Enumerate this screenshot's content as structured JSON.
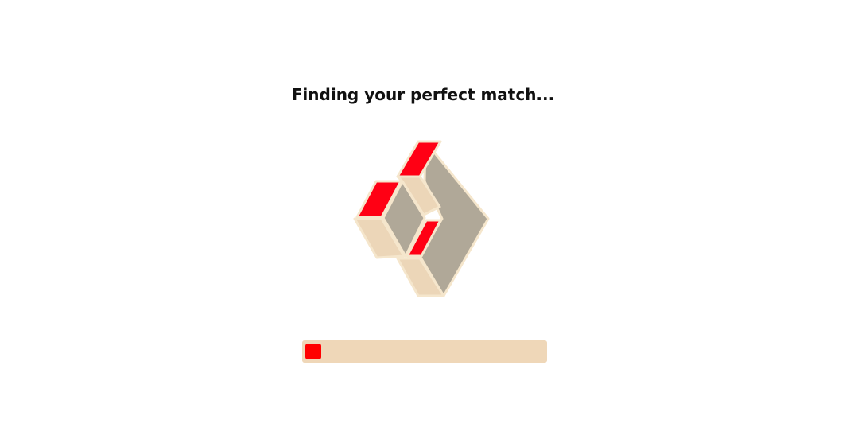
{
  "loading": {
    "title": "Finding your perfect match..."
  },
  "logo": {
    "icon": "isometric-cube-logo-icon",
    "colors": {
      "accent": "#ff0014",
      "shadow": "#b0a898",
      "light": "#ecd6b8",
      "outline": "#f5e6cc"
    }
  },
  "progress": {
    "value_fraction": 0.065,
    "track_color": "#efd7b8",
    "fill_color": "#ff0000"
  }
}
